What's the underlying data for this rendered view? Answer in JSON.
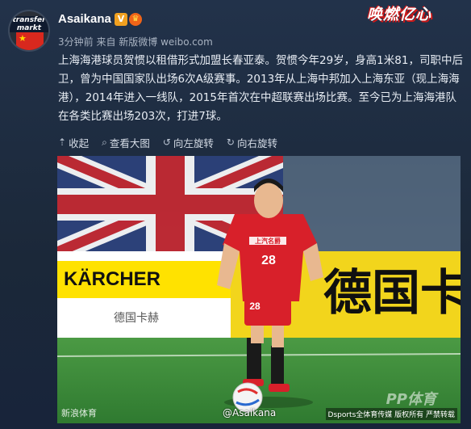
{
  "post": {
    "username": "Asaikana",
    "verified_badge": "V",
    "meta": "3分钟前 来自 新版微博 weibo.com",
    "text": "上海海港球员贺惯以租借形式加盟长春亚泰。贺惯今年29岁，身高1米81，司职中后卫，曾为中国国家队出场6次A级赛事。2013年从上海中邦加入上海东亚（现上海海港），2014年进入一线队，2015年首次在中超联赛出场比赛。至今已为上海海港队在各类比赛出场203次，打进7球。"
  },
  "brand_logo": "唤燃亿心",
  "actions": [
    {
      "label": "收起",
      "icon": "collapse-up-icon"
    },
    {
      "label": "查看大图",
      "icon": "magnifier-icon"
    },
    {
      "label": "向左旋转",
      "icon": "rotate-left-icon"
    },
    {
      "label": "向右旋转",
      "icon": "rotate-right-icon"
    }
  ],
  "photo": {
    "billboard_left": "KÄRCHER",
    "billboard_sub": "德国卡赫",
    "billboard_right": "德国卡",
    "jersey_number": "28",
    "jersey_sponsor": "上汽名爵",
    "watermark": "新浪体育",
    "user_watermark": "@Asaikana",
    "credit_big": "PP体育",
    "credit": "Dsports全体育传媒 版权所有 严禁转载"
  },
  "colors": {
    "background": "#1c2a3c",
    "jersey_red": "#d8202a",
    "pitch_green": "#3f8a3a",
    "billboard_yellow": "#f2d51c"
  }
}
